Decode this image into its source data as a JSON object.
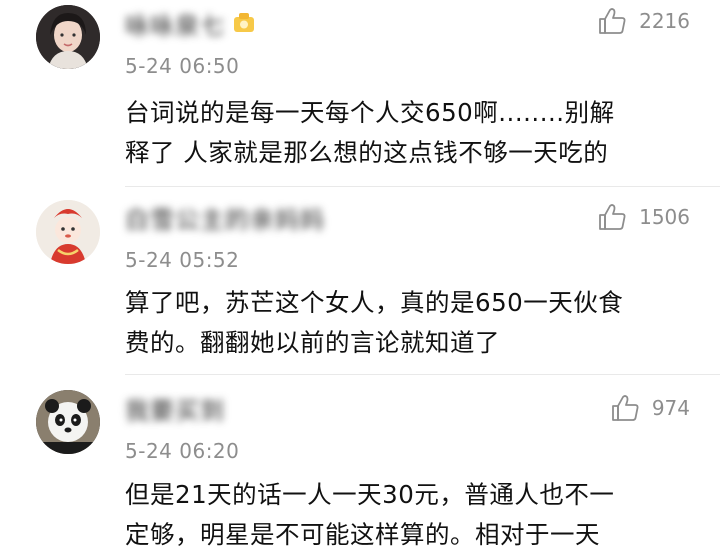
{
  "comments": [
    {
      "username": "咏咏泉七",
      "time": "5-24 06:50",
      "likes": "2216",
      "lines": [
        "台词说的是每一天每个人交650啊........别解",
        "释了 人家就是那么想的这点钱不够一天吃的"
      ],
      "avatar_color": "#3a3434"
    },
    {
      "username": "白雪公主的亲妈妈",
      "time": "5-24 05:52",
      "likes": "1506",
      "lines": [
        "算了吧，苏芒这个女人，真的是650一天伙食",
        "费的。翻翻她以前的言论就知道了"
      ],
      "avatar_color": "#d94a3c"
    },
    {
      "username": "我要买到",
      "time": "5-24 06:20",
      "likes": "974",
      "lines": [
        "但是21天的话一人一天30元，普通人也不一",
        "定够，明星是不可能这样算的。相对于一天"
      ],
      "avatar_color": "#2e2e2e"
    }
  ]
}
